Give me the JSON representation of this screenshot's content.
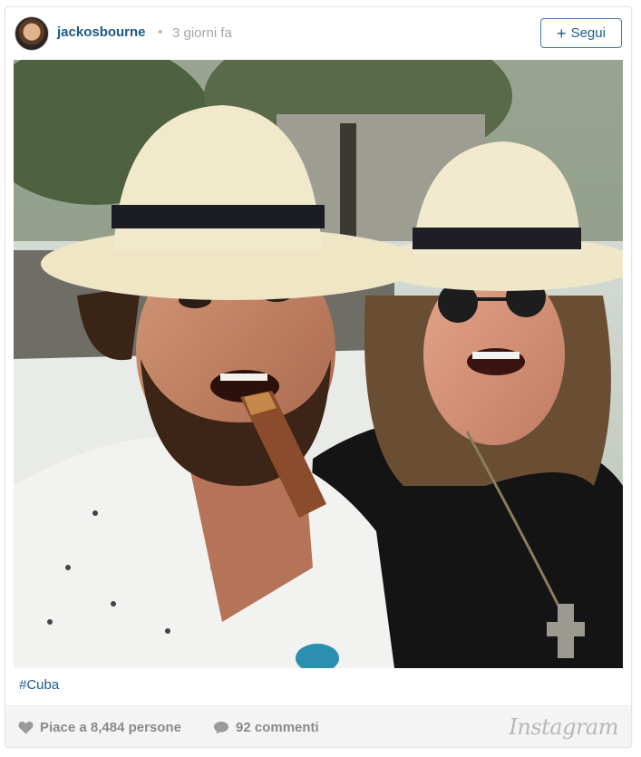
{
  "post": {
    "username": "jackosbourne",
    "separator": "•",
    "time_ago": "3 giorni fa",
    "follow_plus": "+",
    "follow_label": "Segui",
    "caption": "#Cuba"
  },
  "footer": {
    "likes_label": "Piace a 8,484 persone",
    "comments_label": "92 commenti",
    "brand": "Instagram"
  },
  "icons": {
    "avatar": "avatar",
    "like": "heart-icon",
    "comment": "speech-bubble-icon"
  },
  "colors": {
    "link_blue": "#1b5a8a",
    "muted_gray": "#8a8a8a",
    "footer_bg": "#f4f4f4"
  },
  "photo": {
    "description_alt": ""
  }
}
